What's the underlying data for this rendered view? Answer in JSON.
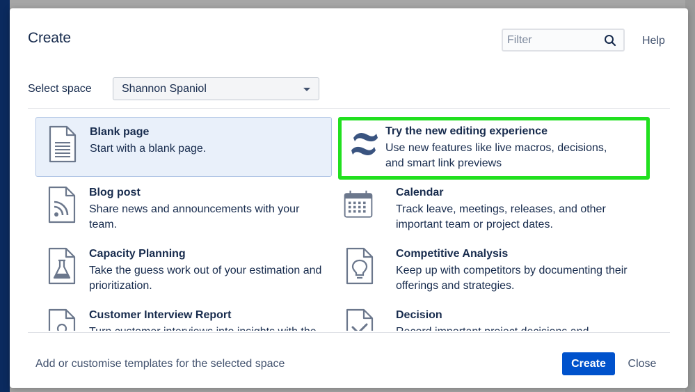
{
  "dialog": {
    "title": "Create",
    "filter_placeholder": "Filter",
    "help_label": "Help",
    "select_space_label": "Select space",
    "selected_space": "Shannon Spaniol"
  },
  "templates": [
    {
      "name": "Blank page",
      "description": "Start with a blank page.",
      "icon": "blank-page-icon"
    },
    {
      "name": "Try the new editing experience",
      "description": "Use new features like live macros, decisions, and smart link previews",
      "icon": "confluence-logo-icon"
    },
    {
      "name": "Blog post",
      "description": "Share news and announcements with your team.",
      "icon": "blog-post-icon"
    },
    {
      "name": "Calendar",
      "description": "Track leave, meetings, releases, and other important team or project dates.",
      "icon": "calendar-icon"
    },
    {
      "name": "Capacity Planning",
      "description": "Take the guess work out of your estimation and prioritization.",
      "icon": "flask-icon"
    },
    {
      "name": "Competitive Analysis",
      "description": "Keep up with competitors by documenting their offerings and strategies.",
      "icon": "lightbulb-icon"
    },
    {
      "name": "Customer Interview Report",
      "description": "Turn customer interviews into insights with the",
      "icon": "customer-interview-icon"
    },
    {
      "name": "Decision",
      "description": "Record important project decisions and",
      "icon": "decision-icon"
    }
  ],
  "footer": {
    "customise_link": "Add or customise templates for the selected space",
    "create_label": "Create",
    "close_label": "Close"
  },
  "colors": {
    "primary": "#0052cc",
    "highlight": "#21e01f",
    "selected_bg": "#e9f0fa"
  }
}
